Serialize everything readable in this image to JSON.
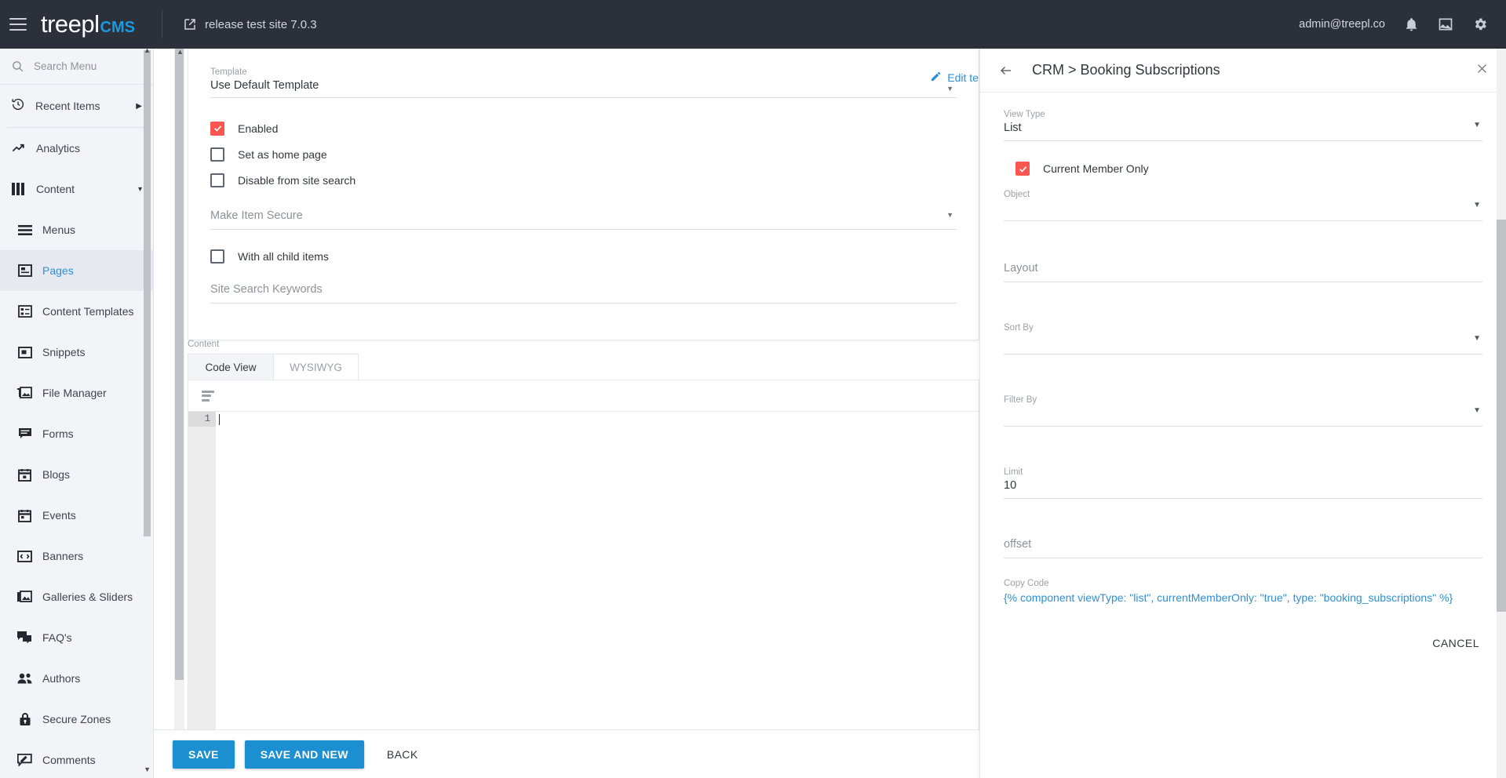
{
  "topbar": {
    "menu_icon": "hamburger-icon",
    "brand_main": "treepl",
    "brand_sub": "CMS",
    "site_name": "release test site 7.0.3",
    "site_icon": "external-link-icon",
    "user_email": "admin@treepl.co",
    "icons": [
      "bell-icon",
      "image-icon",
      "gear-icon"
    ]
  },
  "sidebar": {
    "search_placeholder": "Search Menu",
    "search_value": "",
    "recent": {
      "label": "Recent Items",
      "icon": "history-icon"
    },
    "items": [
      {
        "label": "Analytics",
        "icon": "trending-up-icon",
        "active": false,
        "sub": false
      },
      {
        "label": "Content",
        "icon": "columns-icon",
        "active": false,
        "sub": false,
        "expandable": true
      },
      {
        "label": "Menus",
        "icon": "menu-list-icon",
        "active": false,
        "sub": true
      },
      {
        "label": "Pages",
        "icon": "page-icon",
        "active": true,
        "sub": true
      },
      {
        "label": "Content Templates",
        "icon": "content-template-icon",
        "active": false,
        "sub": true
      },
      {
        "label": "Snippets",
        "icon": "snippet-icon",
        "active": false,
        "sub": true
      },
      {
        "label": "File Manager",
        "icon": "file-manager-icon",
        "active": false,
        "sub": true
      },
      {
        "label": "Forms",
        "icon": "forms-icon",
        "active": false,
        "sub": true
      },
      {
        "label": "Blogs",
        "icon": "blog-calendar-icon",
        "active": false,
        "sub": true
      },
      {
        "label": "Events",
        "icon": "events-calendar-icon",
        "active": false,
        "sub": true
      },
      {
        "label": "Banners",
        "icon": "banner-icon",
        "active": false,
        "sub": true
      },
      {
        "label": "Galleries & Sliders",
        "icon": "gallery-icon",
        "active": false,
        "sub": true
      },
      {
        "label": "FAQ's",
        "icon": "faq-icon",
        "active": false,
        "sub": true
      },
      {
        "label": "Authors",
        "icon": "authors-icon",
        "active": false,
        "sub": true
      },
      {
        "label": "Secure Zones",
        "icon": "lock-icon",
        "active": false,
        "sub": true
      },
      {
        "label": "Comments",
        "icon": "comments-icon",
        "active": false,
        "sub": true
      }
    ]
  },
  "form": {
    "template_label": "Template",
    "template_value": "Use Default Template",
    "edit_template_label": "Edit template",
    "edit_template_icon": "pencil-icon",
    "checkboxes": [
      {
        "label": "Enabled",
        "checked": true
      },
      {
        "label": "Set as home page",
        "checked": false
      },
      {
        "label": "Disable from site search",
        "checked": false
      }
    ],
    "make_item_secure_label": "Make Item Secure",
    "make_item_secure_value": "",
    "with_all_child_items": {
      "label": "With all child items",
      "checked": false
    },
    "site_search_keywords_label": "Site Search Keywords",
    "site_search_keywords_value": "",
    "content_label": "Content",
    "tabs": [
      {
        "label": "Code View",
        "active": true
      },
      {
        "label": "WYSIWYG",
        "active": false
      }
    ],
    "editor": {
      "toolbar_icon": "format-lines-icon",
      "line_numbers": [
        "1"
      ],
      "code": ""
    },
    "footer_buttons": [
      {
        "label": "SAVE",
        "style": "primary"
      },
      {
        "label": "SAVE AND NEW",
        "style": "primary"
      },
      {
        "label": "BACK",
        "style": "flat"
      }
    ]
  },
  "panel": {
    "back_icon": "arrow-left-icon",
    "title": "CRM > Booking Subscriptions",
    "close_icon": "close-icon",
    "fields": [
      {
        "name": "view-type",
        "label": "View Type",
        "value": "List",
        "dropdown": true,
        "big_label": false
      },
      {
        "name": "object",
        "label": "Object",
        "value": "",
        "dropdown": true,
        "big_label": false
      },
      {
        "name": "layout",
        "label": "Layout",
        "value": "",
        "dropdown": false,
        "big_label": true
      },
      {
        "name": "sort-by",
        "label": "Sort By",
        "value": "",
        "dropdown": true,
        "big_label": false
      },
      {
        "name": "filter-by",
        "label": "Filter By",
        "value": "",
        "dropdown": true,
        "big_label": false
      },
      {
        "name": "limit",
        "label": "Limit",
        "value": "10",
        "dropdown": false,
        "big_label": false
      },
      {
        "name": "offset",
        "label": "offset",
        "value": "",
        "dropdown": false,
        "big_label": true
      }
    ],
    "current_member_only": {
      "label": "Current Member Only",
      "checked": true
    },
    "copy_code_label": "Copy Code",
    "copy_code_value": "{% component viewType: \"list\", currentMemberOnly: \"true\", type: \"booking_subscriptions\" %}",
    "cancel_label": "CANCEL"
  },
  "colors": {
    "topbar_bg": "#2b303b",
    "brand_accent": "#1b9ae0",
    "sidebar_bg": "#f2f4f8",
    "active_link": "#2e8fd6",
    "checkbox_checked": "#f9564f",
    "primary_button": "#1b8fd0",
    "code_link": "#2e8fd6"
  }
}
